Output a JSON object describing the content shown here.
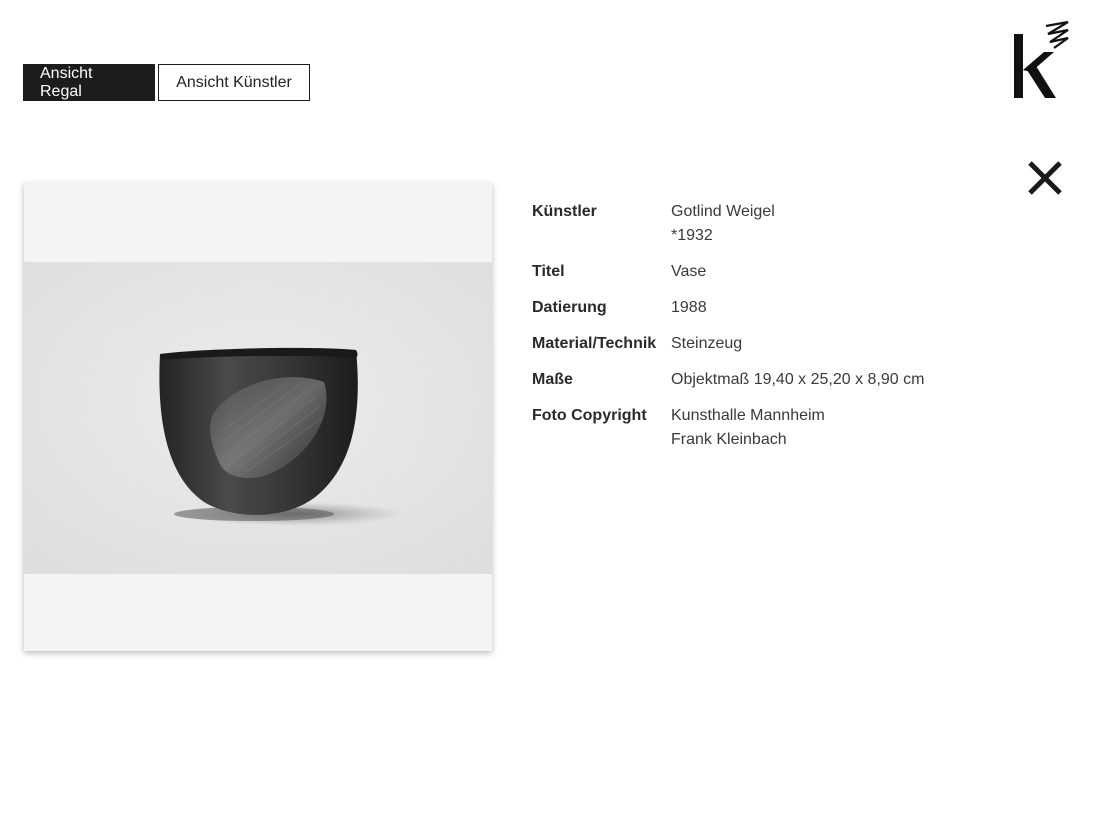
{
  "toolbar": {
    "view_shelf_label": "Ansicht Regal",
    "view_artist_label": "Ansicht Künstler"
  },
  "logo": {
    "icon": "kunsthalle-logo"
  },
  "close": {
    "icon": "close-icon"
  },
  "artwork": {
    "image_subject": "dark stoneware vase",
    "fields": {
      "artist_label": "Künstler",
      "artist_name": "Gotlind Weigel",
      "artist_birth": "*1932",
      "title_label": "Titel",
      "title_value": "Vase",
      "date_label": "Datierung",
      "date_value": "1988",
      "material_label": "Material/Technik",
      "material_value": "Steinzeug",
      "dimensions_label": "Maße",
      "dimensions_value": "Objektmaß 19,40 x 25,20 x 8,90 cm",
      "copyright_label": "Foto Copyright",
      "copyright_line1": "Kunsthalle Mannheim",
      "copyright_line2": "Frank Kleinbach"
    }
  },
  "colors": {
    "button_active_bg": "#1c1c1c",
    "text": "#333333",
    "card_bg": "#f4f4f4"
  }
}
